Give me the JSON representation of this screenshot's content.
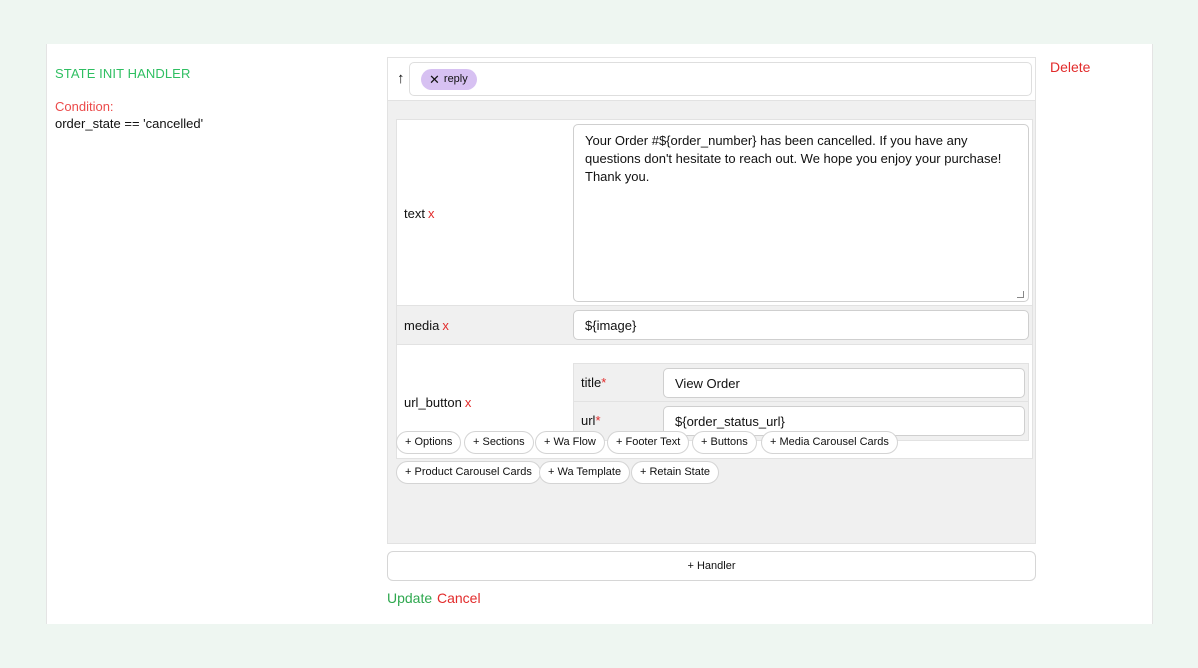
{
  "handler": {
    "title": "STATE INIT HANDLER",
    "condition_label": "Condition:",
    "condition_value": "order_state == 'cancelled'",
    "delete_label": "Delete"
  },
  "action": {
    "up_arrow": "↑",
    "chip_close": "✕",
    "chip_label": "reply"
  },
  "fields": {
    "text": {
      "label": "text",
      "remove": "x",
      "value": "Your Order #${order_number} has been cancelled. If you have any questions don't hesitate to reach out. We hope you enjoy your purchase!\nThank you."
    },
    "media": {
      "label": "media",
      "remove": "x",
      "value": "${image}"
    },
    "url_button": {
      "label": "url_button",
      "remove": "x",
      "title_label": "title",
      "title_value": "View Order",
      "url_label": "url",
      "url_value": "${order_status_url}",
      "required_marker": "*"
    }
  },
  "add_buttons": [
    "+ Options",
    "+ Sections",
    "+ Wa Flow",
    "+ Footer Text",
    "+ Buttons",
    "+ Media Carousel Cards",
    "+ Product Carousel Cards",
    "+ Wa Template",
    "+ Retain State"
  ],
  "footer": {
    "add_handler": "+ Handler",
    "update": "Update",
    "cancel": "Cancel"
  },
  "colors": {
    "green": "#2fbf62",
    "red": "#e22b2b",
    "chip": "#d7c1f2",
    "background": "#eef6f1"
  }
}
